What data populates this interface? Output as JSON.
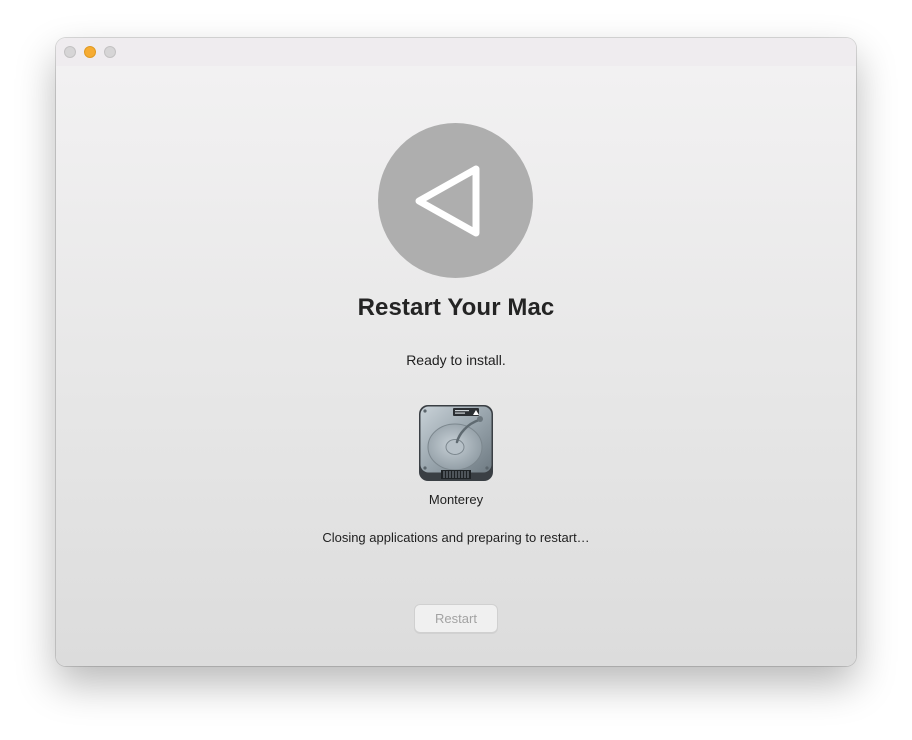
{
  "window": {
    "controls": [
      "close",
      "minimize",
      "zoom"
    ],
    "minimize_color": "#f6ac33",
    "inactive_control_color": "#d6d5d6"
  },
  "hero": {
    "icon": "restart-triangle-icon",
    "circle_color": "#aeaeae",
    "title": "Restart Your Mac",
    "subtitle": "Ready to install."
  },
  "disk": {
    "icon": "hard-drive-icon",
    "label": "Monterey"
  },
  "status": {
    "text": "Closing applications and preparing to restart…"
  },
  "actions": {
    "restart_label": "Restart",
    "restart_enabled": false
  }
}
